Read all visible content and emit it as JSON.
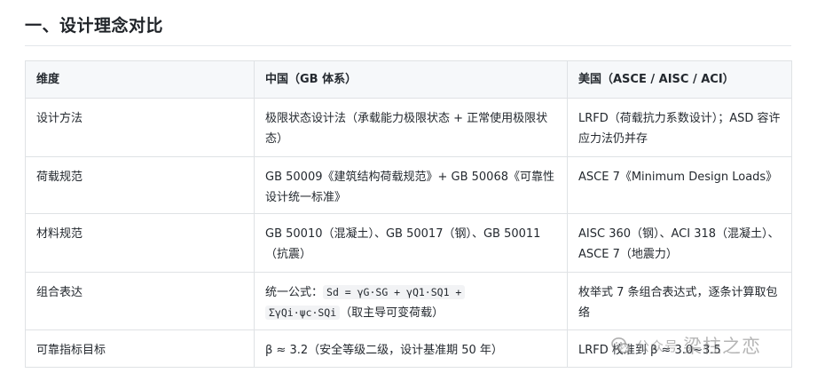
{
  "heading": "一、设计理念对比",
  "table": {
    "headers": [
      "维度",
      "中国（GB 体系）",
      "美国（ASCE / AISC / ACI）"
    ],
    "rows": [
      {
        "dim": "设计方法",
        "cn": "极限状态设计法（承载能力极限状态 + 正常使用极限状态）",
        "us": "LRFD（荷载抗力系数设计）；ASD 容许应力法仍并存"
      },
      {
        "dim": "荷载规范",
        "cn": "GB 50009《建筑结构荷载规范》+ GB 50068《可靠性设计统一标准》",
        "us": "ASCE 7《Minimum Design Loads》"
      },
      {
        "dim": "材料规范",
        "cn": "GB 50010（混凝土）、GB 50017（钢）、GB 50011（抗震）",
        "us": "AISC 360（钢）、ACI 318（混凝土）、ASCE 7（地震力）"
      },
      {
        "dim": "组合表达",
        "cn_prefix": "统一公式：",
        "cn_code1": "Sd = γG·SG + γQ1·SQ1 +",
        "cn_code2": "ΣγQi·ψc·SQi",
        "cn_suffix": "（取主导可变荷载）",
        "us": "枚举式 7 条组合表达式，逐条计算取包络"
      },
      {
        "dim": "可靠指标目标",
        "cn": "β ≈ 3.2（安全等级二级，设计基准期 50 年）",
        "us": "LRFD 校准到 β ≈ 3.0~3.5"
      }
    ]
  },
  "watermark": {
    "prefix": "公众号",
    "name": "梁柱之恋",
    "icon": "wechat-icon"
  }
}
